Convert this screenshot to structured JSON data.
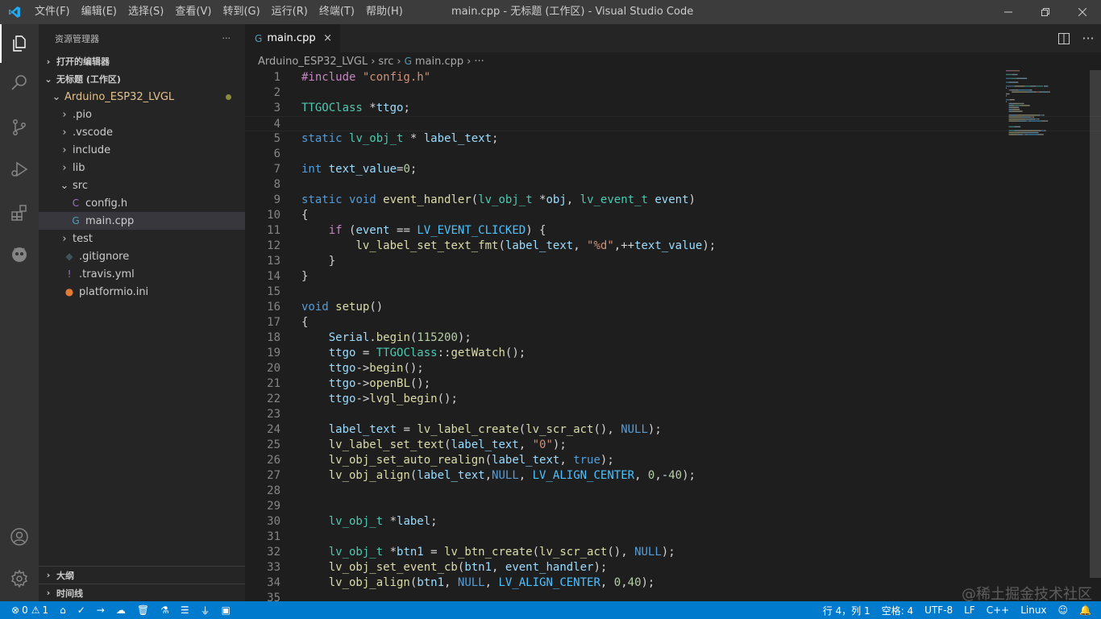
{
  "colors": {
    "accent": "#007acc",
    "keyword": "#569cd6",
    "type": "#4ec9b0",
    "string": "#ce9178",
    "number": "#b5cea8",
    "function": "#dcdcaa",
    "variable": "#9cdcfe",
    "macro": "#4fc1ff",
    "directive": "#c586c0",
    "folder_highlight": "#e2c08d"
  },
  "titlebar": {
    "menus": [
      "文件(F)",
      "编辑(E)",
      "选择(S)",
      "查看(V)",
      "转到(G)",
      "运行(R)",
      "终端(T)",
      "帮助(H)"
    ],
    "title": "main.cpp - 无标题 (工作区) - Visual Studio Code"
  },
  "activity": [
    "explorer-icon",
    "search-icon",
    "source-control-icon",
    "run-debug-icon",
    "extensions-icon",
    "platformio-icon",
    "account-icon",
    "settings-gear-icon"
  ],
  "sidebar": {
    "header": "资源管理器",
    "more": "···",
    "open_editors": "打开的编辑器",
    "workspace": "无标题 (工作区)",
    "outline": "大纲",
    "timeline": "时间线",
    "tree": [
      {
        "label": "Arduino_ESP32_LVGL",
        "indent": 1,
        "chev": "v",
        "icon": "",
        "modified": true
      },
      {
        "label": ".pio",
        "indent": 2,
        "chev": ">",
        "icon": ""
      },
      {
        "label": ".vscode",
        "indent": 2,
        "chev": ">",
        "icon": ""
      },
      {
        "label": "include",
        "indent": 2,
        "chev": ">",
        "icon": ""
      },
      {
        "label": "lib",
        "indent": 2,
        "chev": ">",
        "icon": ""
      },
      {
        "label": "src",
        "indent": 2,
        "chev": "v",
        "icon": ""
      },
      {
        "label": "config.h",
        "indent": 3,
        "chev": "",
        "icon": "C",
        "iconColor": "#a074c4"
      },
      {
        "label": "main.cpp",
        "indent": 3,
        "chev": "",
        "icon": "G",
        "iconColor": "#519aba",
        "selected": true
      },
      {
        "label": "test",
        "indent": 2,
        "chev": ">",
        "icon": ""
      },
      {
        "label": ".gitignore",
        "indent": 2,
        "chev": "",
        "icon": "◆",
        "iconColor": "#41535b"
      },
      {
        "label": ".travis.yml",
        "indent": 2,
        "chev": "",
        "icon": "!",
        "iconColor": "#a074c4"
      },
      {
        "label": "platformio.ini",
        "indent": 2,
        "chev": "",
        "icon": "●",
        "iconColor": "#e37933"
      }
    ]
  },
  "editor": {
    "tab": "main.cpp",
    "tab_close": "×",
    "breadcrumb": [
      "Arduino_ESP32_LVGL",
      "src",
      "main.cpp",
      "···"
    ],
    "lines": [
      [
        [
          "#include ",
          "dir"
        ],
        [
          "\"config.h\"",
          "str"
        ]
      ],
      [],
      [
        [
          "TTGOClass",
          "type"
        ],
        [
          " *",
          "p"
        ],
        [
          "ttgo",
          "var"
        ],
        [
          ";",
          "p"
        ]
      ],
      [],
      [
        [
          "static ",
          "kw"
        ],
        [
          "lv_obj_t",
          "type"
        ],
        [
          " * ",
          "p"
        ],
        [
          "label_text",
          "var"
        ],
        [
          ";",
          "p"
        ]
      ],
      [],
      [
        [
          "int ",
          "kw"
        ],
        [
          "text_value",
          "var"
        ],
        [
          "=",
          "p"
        ],
        [
          "0",
          "num"
        ],
        [
          ";",
          "p"
        ]
      ],
      [],
      [
        [
          "static ",
          "kw"
        ],
        [
          "void ",
          "kw"
        ],
        [
          "event_handler",
          "fn"
        ],
        [
          "(",
          "p"
        ],
        [
          "lv_obj_t",
          "type"
        ],
        [
          " *",
          "p"
        ],
        [
          "obj",
          "var"
        ],
        [
          ", ",
          "p"
        ],
        [
          "lv_event_t",
          "type"
        ],
        [
          " ",
          "p"
        ],
        [
          "event",
          "var"
        ],
        [
          ")",
          "p"
        ]
      ],
      [
        [
          "{",
          "p"
        ]
      ],
      [
        [
          "    ",
          "p"
        ],
        [
          "if ",
          "dir"
        ],
        [
          "(",
          "p"
        ],
        [
          "event",
          "var"
        ],
        [
          " == ",
          "p"
        ],
        [
          "LV_EVENT_CLICKED",
          "mac"
        ],
        [
          ") {",
          "p"
        ]
      ],
      [
        [
          "        ",
          "p"
        ],
        [
          "lv_label_set_text_fmt",
          "fn"
        ],
        [
          "(",
          "p"
        ],
        [
          "label_text",
          "var"
        ],
        [
          ", ",
          "p"
        ],
        [
          "\"%d\"",
          "str"
        ],
        [
          ",++",
          "p"
        ],
        [
          "text_value",
          "var"
        ],
        [
          ");",
          "p"
        ]
      ],
      [
        [
          "    }",
          "p"
        ]
      ],
      [
        [
          "}",
          "p"
        ]
      ],
      [],
      [
        [
          "void ",
          "kw"
        ],
        [
          "setup",
          "fn"
        ],
        [
          "()",
          "p"
        ]
      ],
      [
        [
          "{",
          "p"
        ]
      ],
      [
        [
          "    ",
          "p"
        ],
        [
          "Serial",
          "var"
        ],
        [
          ".",
          "p"
        ],
        [
          "begin",
          "fn"
        ],
        [
          "(",
          "p"
        ],
        [
          "115200",
          "num"
        ],
        [
          ");",
          "p"
        ]
      ],
      [
        [
          "    ",
          "p"
        ],
        [
          "ttgo",
          "var"
        ],
        [
          " = ",
          "p"
        ],
        [
          "TTGOClass",
          "type"
        ],
        [
          "::",
          "p"
        ],
        [
          "getWatch",
          "fn"
        ],
        [
          "();",
          "p"
        ]
      ],
      [
        [
          "    ",
          "p"
        ],
        [
          "ttgo",
          "var"
        ],
        [
          "->",
          "p"
        ],
        [
          "begin",
          "fn"
        ],
        [
          "();",
          "p"
        ]
      ],
      [
        [
          "    ",
          "p"
        ],
        [
          "ttgo",
          "var"
        ],
        [
          "->",
          "p"
        ],
        [
          "openBL",
          "fn"
        ],
        [
          "();",
          "p"
        ]
      ],
      [
        [
          "    ",
          "p"
        ],
        [
          "ttgo",
          "var"
        ],
        [
          "->",
          "p"
        ],
        [
          "lvgl_begin",
          "fn"
        ],
        [
          "();",
          "p"
        ]
      ],
      [],
      [
        [
          "    ",
          "p"
        ],
        [
          "label_text",
          "var"
        ],
        [
          " = ",
          "p"
        ],
        [
          "lv_label_create",
          "fn"
        ],
        [
          "(",
          "p"
        ],
        [
          "lv_scr_act",
          "fn"
        ],
        [
          "(), ",
          "p"
        ],
        [
          "NULL",
          "kw"
        ],
        [
          ");",
          "p"
        ]
      ],
      [
        [
          "    ",
          "p"
        ],
        [
          "lv_label_set_text",
          "fn"
        ],
        [
          "(",
          "p"
        ],
        [
          "label_text",
          "var"
        ],
        [
          ", ",
          "p"
        ],
        [
          "\"0\"",
          "str"
        ],
        [
          ");",
          "p"
        ]
      ],
      [
        [
          "    ",
          "p"
        ],
        [
          "lv_obj_set_auto_realign",
          "fn"
        ],
        [
          "(",
          "p"
        ],
        [
          "label_text",
          "var"
        ],
        [
          ", ",
          "p"
        ],
        [
          "true",
          "kw"
        ],
        [
          ");",
          "p"
        ]
      ],
      [
        [
          "    ",
          "p"
        ],
        [
          "lv_obj_align",
          "fn"
        ],
        [
          "(",
          "p"
        ],
        [
          "label_text",
          "var"
        ],
        [
          ",",
          "p"
        ],
        [
          "NULL",
          "kw"
        ],
        [
          ", ",
          "p"
        ],
        [
          "LV_ALIGN_CENTER",
          "mac"
        ],
        [
          ", ",
          "p"
        ],
        [
          "0",
          "num"
        ],
        [
          ",-",
          "p"
        ],
        [
          "40",
          "num"
        ],
        [
          ");",
          "p"
        ]
      ],
      [],
      [],
      [
        [
          "    ",
          "p"
        ],
        [
          "lv_obj_t",
          "type"
        ],
        [
          " *",
          "p"
        ],
        [
          "label",
          "var"
        ],
        [
          ";",
          "p"
        ]
      ],
      [],
      [
        [
          "    ",
          "p"
        ],
        [
          "lv_obj_t",
          "type"
        ],
        [
          " *",
          "p"
        ],
        [
          "btn1",
          "var"
        ],
        [
          " = ",
          "p"
        ],
        [
          "lv_btn_create",
          "fn"
        ],
        [
          "(",
          "p"
        ],
        [
          "lv_scr_act",
          "fn"
        ],
        [
          "(), ",
          "p"
        ],
        [
          "NULL",
          "kw"
        ],
        [
          ");",
          "p"
        ]
      ],
      [
        [
          "    ",
          "p"
        ],
        [
          "lv_obj_set_event_cb",
          "fn"
        ],
        [
          "(",
          "p"
        ],
        [
          "btn1",
          "var"
        ],
        [
          ", ",
          "p"
        ],
        [
          "event_handler",
          "var"
        ],
        [
          ");",
          "p"
        ]
      ],
      [
        [
          "    ",
          "p"
        ],
        [
          "lv_obj_align",
          "fn"
        ],
        [
          "(",
          "p"
        ],
        [
          "btn1",
          "var"
        ],
        [
          ", ",
          "p"
        ],
        [
          "NULL",
          "kw"
        ],
        [
          ", ",
          "p"
        ],
        [
          "LV_ALIGN_CENTER",
          "mac"
        ],
        [
          ", ",
          "p"
        ],
        [
          "0",
          "num"
        ],
        [
          ",",
          "p"
        ],
        [
          "40",
          "num"
        ],
        [
          ");",
          "p"
        ]
      ],
      []
    ]
  },
  "statusbar": {
    "errors": "0",
    "warnings": "1",
    "position": "行 4，列 1",
    "spaces": "空格: 4",
    "encoding": "UTF-8",
    "eol": "LF",
    "language": "C++",
    "os": "Linux"
  },
  "watermark": "@稀土掘金技术社区"
}
